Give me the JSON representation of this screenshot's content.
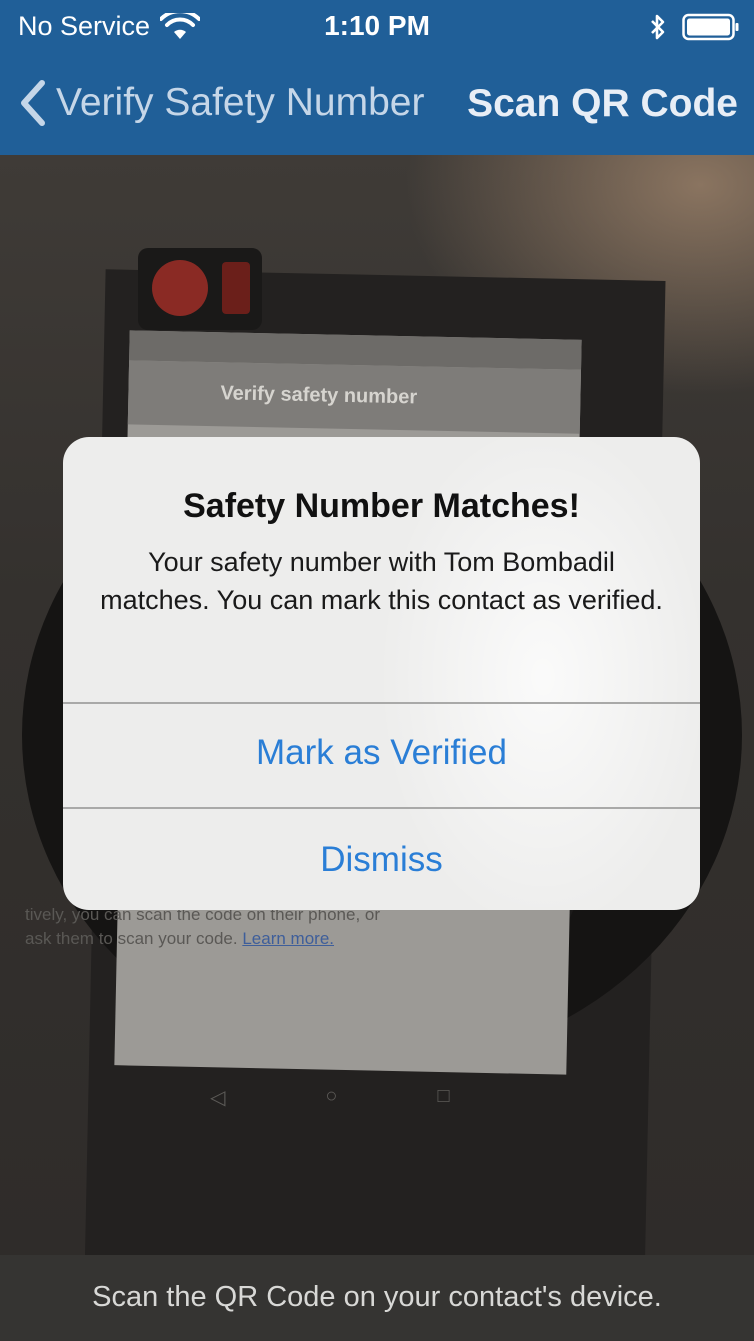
{
  "status_bar": {
    "carrier": "No Service",
    "time": "1:10 PM"
  },
  "nav": {
    "back_label": "Verify Safety Number",
    "title": "Scan QR Code"
  },
  "camera_preview": {
    "phone_title": "Verify safety number",
    "phone_text_1": "tively, you can scan the code on their phone, or",
    "phone_text_2": "ask them to scan your code.",
    "phone_link": "Learn more."
  },
  "alert": {
    "title": "Safety Number Matches!",
    "message": "Your safety number with Tom Bombadil matches. You can mark this contact as verified.",
    "primary_button": "Mark as Verified",
    "secondary_button": "Dismiss"
  },
  "footer": {
    "instruction": "Scan the QR Code on your contact's device."
  },
  "colors": {
    "nav_blue": "#205f98",
    "ios_link_blue": "#2a7ed6"
  }
}
